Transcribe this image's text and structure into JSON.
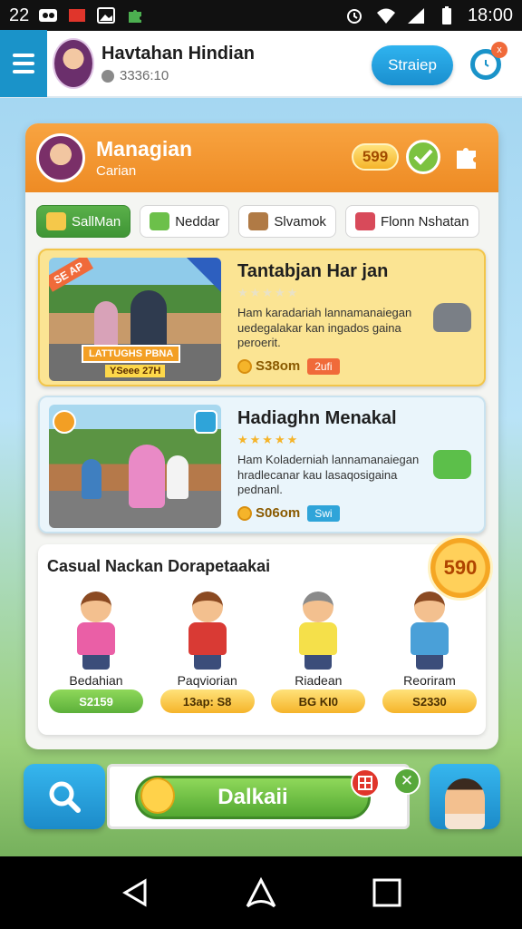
{
  "status_bar": {
    "left_number": "22",
    "time": "18:00",
    "icons": [
      "media-icon",
      "app-badge-icon",
      "gallery-icon",
      "puzzle-icon",
      "alarm-icon",
      "wifi-icon",
      "signal-icon",
      "battery-icon"
    ]
  },
  "header": {
    "user_name": "Havtahan Hindian",
    "user_sub": "3336:10",
    "primary_button": "Straiep",
    "notification_badge": "x"
  },
  "card": {
    "title": "Managian",
    "subtitle": "Carian",
    "coins": "599",
    "filters": [
      {
        "label": "SallMan"
      },
      {
        "label": "Neddar"
      },
      {
        "label": "Slvamok"
      },
      {
        "label": "Flonn Nshatan"
      }
    ],
    "listings": [
      {
        "title": "Tantabjan Har jan",
        "desc": "Ham karadariah lannamanaiegan uedegalakar kan ingados gaina peroerit.",
        "price": "S38om",
        "tag": "2ufi",
        "ribbon": "SE AP",
        "banner": "LATTUGHS PBNA",
        "banner_sub": "YSeee 27H"
      },
      {
        "title": "Hadiaghn Menakal",
        "desc": "Ham Koladerniah lannamanaiegan hradlecanar kau lasaqosigaina pednanl.",
        "price": "S06om",
        "tag": "Swi"
      }
    ],
    "casual": {
      "title": "Casual Nackan Dorapetaakai",
      "badge": "590",
      "people": [
        {
          "name": "Bedahian",
          "price": "S2159"
        },
        {
          "name": "Paqviorian",
          "price": "13ap: S8"
        },
        {
          "name": "Riadean",
          "price": "BG KI0"
        },
        {
          "name": "Reoriram",
          "price": "S2330"
        }
      ]
    }
  },
  "bottom": {
    "cta_label": "Dalkaii"
  },
  "colors": {
    "accent_blue": "#1a93c9",
    "header_orange": "#f8a441",
    "success_green": "#5cb03a",
    "gold": "#f5b42a"
  }
}
